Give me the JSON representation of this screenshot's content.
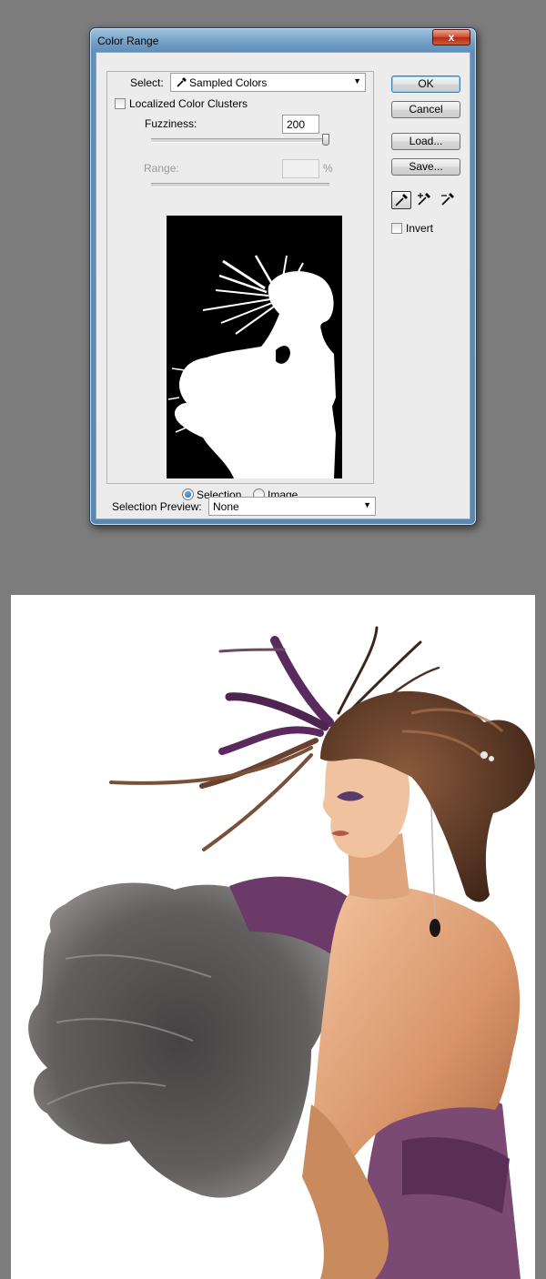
{
  "dialog": {
    "title": "Color Range",
    "close_glyph": "x",
    "select_label": "Select:",
    "select_value": "Sampled Colors",
    "localized_label": "Localized Color Clusters",
    "localized_checked": false,
    "fuzziness_label": "Fuzziness:",
    "fuzziness_value": "200",
    "range_label": "Range:",
    "range_value": "",
    "range_unit": "%",
    "fuzziness_level_fraction": 1.0,
    "radio_selection_label": "Selection",
    "radio_image_label": "Image",
    "radio_selected": "Selection",
    "preview_label": "Selection Preview:",
    "preview_value": "None",
    "buttons": {
      "ok": "OK",
      "cancel": "Cancel",
      "load": "Load...",
      "save": "Save..."
    },
    "invert_label": "Invert",
    "invert_checked": false,
    "tools": [
      "eyedropper-icon",
      "eyedropper-plus-icon",
      "eyedropper-minus-icon"
    ]
  },
  "colors": {
    "titlebar": "#6e9bc2",
    "client": "#ececec",
    "close": "#c83a1e",
    "background": "#7c7c7c"
  }
}
